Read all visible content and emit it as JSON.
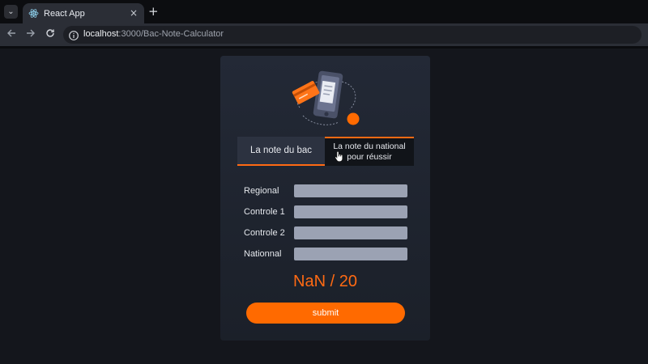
{
  "browser": {
    "tab_title": "React App",
    "close_glyph": "×",
    "new_tab_glyph": "+",
    "url_host": "localhost",
    "url_path": ":3000/Bac-Note-Calculator"
  },
  "calculator": {
    "tabs": [
      {
        "label": "La note du bac",
        "active": true
      },
      {
        "label_line1": "La note du national",
        "label_line2": "pour réussir",
        "active": false
      }
    ],
    "fields": [
      {
        "label": "Regional",
        "value": ""
      },
      {
        "label": "Controle 1",
        "value": ""
      },
      {
        "label": "Controle 2",
        "value": ""
      },
      {
        "label": "Nationnal",
        "value": ""
      }
    ],
    "result": "NaN / 20",
    "submit_label": "submit"
  },
  "colors": {
    "accent": "#ff6a00",
    "card_bg": "#1f2430",
    "input_bg": "#9ba2b3",
    "page_bg": "#14161c"
  },
  "icons": [
    "chevron-down-icon",
    "react-icon",
    "close-icon",
    "plus-icon",
    "back-arrow-icon",
    "forward-arrow-icon",
    "reload-icon",
    "site-info-icon",
    "hand-cursor-icon"
  ]
}
